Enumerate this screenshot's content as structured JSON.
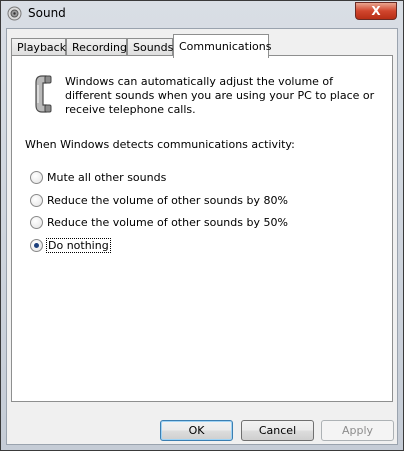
{
  "window": {
    "title": "Sound",
    "close_symbol": "X"
  },
  "tabs": [
    {
      "label": "Playback",
      "active": false
    },
    {
      "label": "Recording",
      "active": false
    },
    {
      "label": "Sounds",
      "active": false
    },
    {
      "label": "Communications",
      "active": true
    }
  ],
  "communications": {
    "icon": "telephone-handset-icon",
    "description": "Windows can automatically adjust the volume of different sounds when you are using your PC to place or receive telephone calls.",
    "detect_label": "When Windows detects communications activity:",
    "options": [
      {
        "label": "Mute all other sounds",
        "selected": false
      },
      {
        "label": "Reduce the volume of other sounds by 80%",
        "selected": false
      },
      {
        "label": "Reduce the volume of other sounds by 50%",
        "selected": false
      },
      {
        "label": "Do nothing",
        "selected": true
      }
    ]
  },
  "buttons": {
    "ok": "OK",
    "cancel": "Cancel",
    "apply": "Apply",
    "apply_enabled": false
  }
}
